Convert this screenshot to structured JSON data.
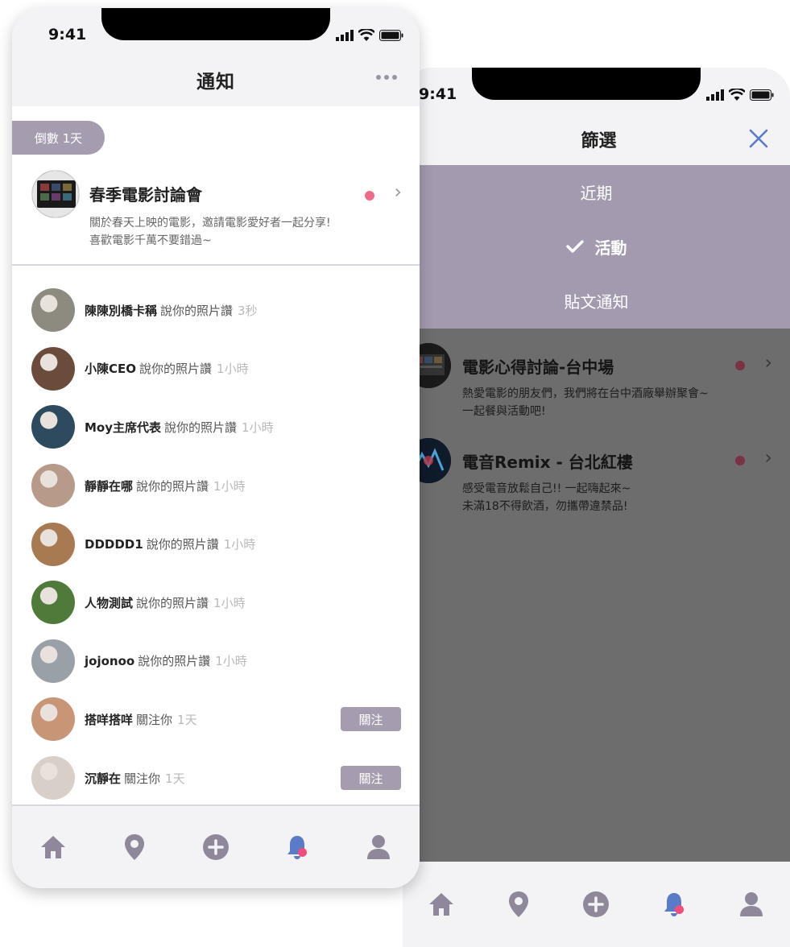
{
  "colors": {
    "accent_purple": "#a69cb0",
    "menu_purple": "#a39ab0",
    "icon_gray_purple": "#8f889a",
    "notification_dot": "#f06a8a",
    "close_blue": "#5a7cc8",
    "overlay_gray": "#6d6d6d"
  },
  "front": {
    "status_time": "9:41",
    "title": "通知",
    "countdown": "倒數 1天",
    "event": {
      "title": "春季電影討論會",
      "desc_line1": "關於春天上映的電影，邀請電影愛好者一起分享!",
      "desc_line2": "喜歡電影千萬不要錯過~"
    },
    "notifications": [
      {
        "name": "陳陳別橋卡稱",
        "action": "說你的照片讚",
        "time": "3秒",
        "avatar_color": "#8d8a80"
      },
      {
        "name": "小陳CEO",
        "action": "說你的照片讚",
        "time": "1小時",
        "avatar_color": "#6b4b3b"
      },
      {
        "name": "Moy主席代表",
        "action": "說你的照片讚",
        "time": "1小時",
        "avatar_color": "#2d4a5e"
      },
      {
        "name": "靜靜在哪",
        "action": "說你的照片讚",
        "time": "1小時",
        "avatar_color": "#b89a8a"
      },
      {
        "name": "DDDDD1",
        "action": "說你的照片讚",
        "time": "1小時",
        "avatar_color": "#a87a52"
      },
      {
        "name": "人物測試",
        "action": "說你的照片讚",
        "time": "1小時",
        "avatar_color": "#4f7a3a"
      },
      {
        "name": "jojonoo",
        "action": "說你的照片讚",
        "time": "1小時",
        "avatar_color": "#9aa0a8"
      },
      {
        "name": "搭咩搭咩",
        "action": "關注你",
        "time": "1天",
        "avatar_color": "#c99577",
        "button": "關注"
      },
      {
        "name": "沉靜在",
        "action": "關注你",
        "time": "1天",
        "avatar_color": "#d8cfc8",
        "button": "關注"
      }
    ],
    "tabs": [
      {
        "icon": "home-icon"
      },
      {
        "icon": "location-pin-icon"
      },
      {
        "icon": "add-circle-icon"
      },
      {
        "icon": "bell-icon",
        "badge": true
      },
      {
        "icon": "profile-icon"
      }
    ]
  },
  "back": {
    "status_time": "9:41",
    "title": "篩選",
    "filter_options": [
      {
        "label": "近期",
        "selected": false
      },
      {
        "label": "活動",
        "selected": true
      },
      {
        "label": "貼文通知",
        "selected": false
      }
    ],
    "events": [
      {
        "title": "電影心得討論-台中場",
        "desc_line1": "熱愛電影的朋友們，我們將在台中酒廠舉辦聚會~",
        "desc_line2": "一起餐與活動吧!"
      },
      {
        "title": "電音Remix - 台北紅樓",
        "desc_line1": "感受電音放鬆自己!! 一起嗨起來~",
        "desc_line2": "未滿18不得飲酒，勿攜帶違禁品!"
      }
    ]
  }
}
